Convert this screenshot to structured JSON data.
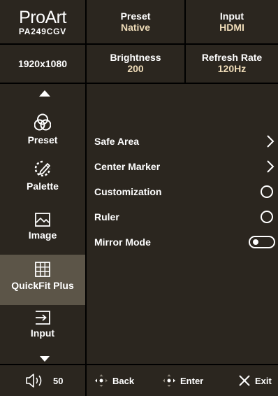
{
  "header": {
    "brand": "ProArt",
    "model": "PA249CGV",
    "resolution": "1920x1080",
    "preset": {
      "label": "Preset",
      "value": "Native"
    },
    "input": {
      "label": "Input",
      "value": "HDMI"
    },
    "brightness": {
      "label": "Brightness",
      "value": "200"
    },
    "refresh_rate": {
      "label": "Refresh Rate",
      "value": "120Hz"
    }
  },
  "sidebar": {
    "items": [
      {
        "label": "Preset",
        "icon": "preset-rings-icon"
      },
      {
        "label": "Palette",
        "icon": "palette-icon"
      },
      {
        "label": "Image",
        "icon": "image-icon"
      },
      {
        "label": "QuickFit Plus",
        "icon": "grid-icon",
        "selected": true
      },
      {
        "label": "Input",
        "icon": "input-icon"
      }
    ]
  },
  "menu": {
    "items": [
      {
        "label": "Safe Area",
        "control": "chevron-right"
      },
      {
        "label": "Center Marker",
        "control": "chevron-right"
      },
      {
        "label": "Customization",
        "control": "radio-off"
      },
      {
        "label": "Ruler",
        "control": "radio-off"
      },
      {
        "label": "Mirror Mode",
        "control": "toggle-off"
      }
    ]
  },
  "footer": {
    "volume": "50",
    "back": "Back",
    "enter": "Enter",
    "exit": "Exit"
  },
  "colors": {
    "panel": "#2b261f",
    "selected": "#5c5548",
    "value_text": "#efdcb8"
  }
}
